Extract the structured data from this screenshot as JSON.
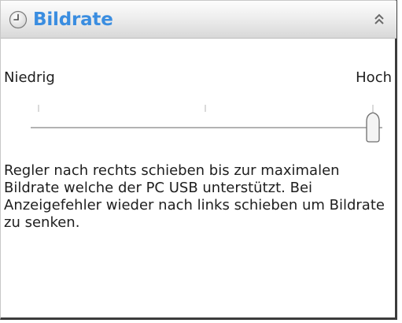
{
  "panel": {
    "title": "Bildrate",
    "title_icon": "clock-icon",
    "collapse_icon": "double-chevron-up-icon",
    "accent_color": "#3a8de0"
  },
  "slider": {
    "label_low": "Niedrig",
    "label_high": "Hoch",
    "value_fraction": 1.0,
    "tick_count": 3
  },
  "description": "Regler nach rechts schieben bis zur maximalen Bildrate welche der PC USB unterstützt. Bei Anzeigefehler wieder nach links schieben um Bildrate zu senken."
}
